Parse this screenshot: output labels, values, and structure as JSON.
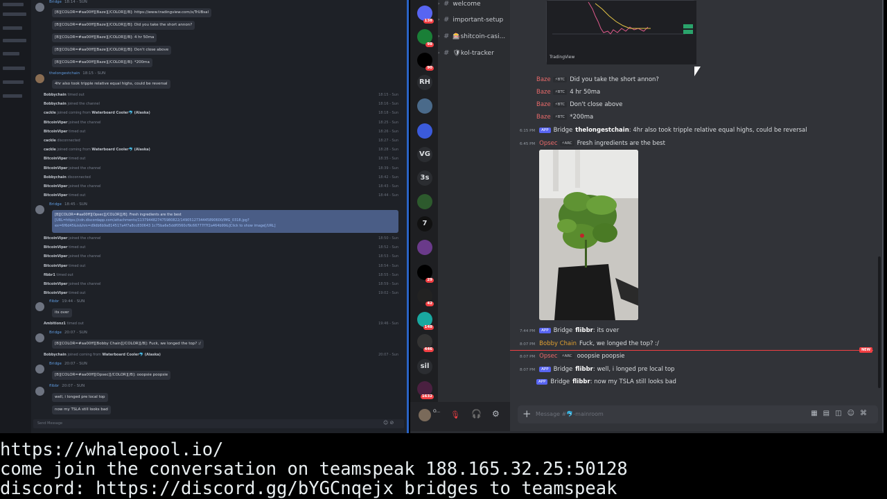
{
  "teamspeak": {
    "messages": [
      {
        "name": "Bridge",
        "time": "18:14 - SUN",
        "lines": [
          "[B][COLOR=#aa00ff][Baze][/COLOR][/B]: https://www.tradingview.com/x/TrUBsal",
          "[B][COLOR=#aa00ff][Baze][/COLOR][/B]: Did you take the short annon?",
          "[B][COLOR=#aa00ff][Baze][/COLOR][/B]: 4 hr 50ma",
          "[B][COLOR=#aa00ff][Baze][/COLOR][/B]: Don't close above",
          "[B][COLOR=#aa00ff][Baze][/COLOR][/B]: *200ma"
        ]
      },
      {
        "name": "thelongestchain",
        "time": "18:15 - SUN",
        "lines": [
          "4hr also took tripple relative equal highs, could be reversal"
        ]
      }
    ],
    "events1": [
      {
        "user": "Bobbychain",
        "text": "timed out",
        "time": "18:15 - Sun"
      },
      {
        "user": "Bobbychain",
        "text": "joined the channel",
        "time": "18:16 - Sun"
      },
      {
        "user": "cackle",
        "text": "joined coming from",
        "extra": "Waterboard Cooler🐬 (Alaska)",
        "time": "18:18 - Sun"
      },
      {
        "user": "BitcoinViper",
        "text": "joined the channel",
        "time": "18:25 - Sun"
      },
      {
        "user": "BitcoinViper",
        "text": "timed out",
        "time": "18:26 - Sun"
      },
      {
        "user": "cackle",
        "text": "disconnected",
        "time": "18:27 - Sun"
      },
      {
        "user": "cackle",
        "text": "joined coming from",
        "extra": "Waterboard Cooler🐬 (Alaska)",
        "time": "18:28 - Sun"
      },
      {
        "user": "BitcoinViper",
        "text": "timed out",
        "time": "18:35 - Sun"
      },
      {
        "user": "BitcoinViper",
        "text": "joined the channel",
        "time": "18:39 - Sun"
      },
      {
        "user": "Bobbychain",
        "text": "disconnected",
        "time": "18:42 - Sun"
      },
      {
        "user": "BitcoinViper",
        "text": "joined the channel",
        "time": "18:43 - Sun"
      },
      {
        "user": "BitcoinViper",
        "text": "timed out",
        "time": "18:44 - Sun"
      }
    ],
    "hl": {
      "name": "Bridge",
      "time": "18:45 - SUN",
      "line1": "[B][COLOR=#aa00ff][Opsec][/COLOR][/B]: Fresh ingredients are the best",
      "line2": "[URL=https://cdn.discordapp.com/attachments/1137944827475980822/1490512734445890600/IMG_0318.jpg?",
      "line3": "ex=6f6d45&is&hm=d9db6b9a814517a4f7a8cc830643 1c75ba6e5ddf0560cf9c66777f7f2a464b99&]Click to show image[/URL]"
    },
    "events2": [
      {
        "user": "BitcoinViper",
        "text": "joined the channel",
        "time": "18:50 - Sun"
      },
      {
        "user": "BitcoinViper",
        "text": "timed out",
        "time": "18:52 - Sun"
      },
      {
        "user": "BitcoinViper",
        "text": "joined the channel",
        "time": "18:53 - Sun"
      },
      {
        "user": "BitcoinViper",
        "text": "timed out",
        "time": "18:54 - Sun"
      },
      {
        "user": "fibbr1",
        "text": "timed out",
        "time": "18:55 - Sun"
      },
      {
        "user": "BitcoinViper",
        "text": "joined the channel",
        "time": "18:59 - Sun"
      },
      {
        "user": "BitcoinViper",
        "text": "timed out",
        "time": "19:02 - Sun"
      }
    ],
    "m3": {
      "name": "flibbr",
      "time": "19:44 - SUN",
      "line": "its over"
    },
    "ev3": {
      "user": "Ambitionz1",
      "text": "timed out",
      "time": "19:46 - Sun"
    },
    "m4": {
      "name": "Bridge",
      "time": "20:07 - SUN",
      "line": "[B][COLOR=#aa00ff][Bobby Chain][/COLOR][/B]: Fuck, we longed the top? :/"
    },
    "ev4": {
      "user": "Bobbychain",
      "text": "joined coming from",
      "extra": "Waterboard Cooler🐬 (Alaska)",
      "time": "20:07 - Sun"
    },
    "m5": {
      "name": "Bridge",
      "time": "20:07 - SUN",
      "line": "[B][COLOR=#aa00ff][Opsec][/COLOR][/B]: ooopsie poopsie"
    },
    "m6": {
      "name": "flibbr",
      "time": "20:07 - SUN",
      "lines": [
        "well, i longed pre local top",
        "now my TSLA still looks bad"
      ]
    },
    "input_placeholder": "Send Message"
  },
  "discord": {
    "servers": [
      {
        "label": "",
        "badge": "138"
      },
      {
        "label": "",
        "badge": "98"
      },
      {
        "label": "",
        "badge": "90"
      },
      {
        "label": "RH",
        "badge": ""
      },
      {
        "label": "",
        "badge": ""
      },
      {
        "label": "",
        "badge": ""
      },
      {
        "label": "VG",
        "badge": ""
      },
      {
        "label": "3s",
        "badge": ""
      },
      {
        "label": "",
        "badge": ""
      },
      {
        "label": "7",
        "badge": ""
      },
      {
        "label": "",
        "badge": ""
      },
      {
        "label": "",
        "badge": "29"
      },
      {
        "label": "",
        "badge": "42"
      },
      {
        "label": "",
        "badge": "148"
      },
      {
        "label": "",
        "badge": "446"
      },
      {
        "label": "sil",
        "badge": ""
      },
      {
        "label": "",
        "badge": "1632"
      }
    ],
    "channels": [
      "welcome",
      "important-setup",
      "🎰shitcoin-casi...",
      "🛡kol-tracker"
    ],
    "chart_brand": "TradingView",
    "messages": [
      {
        "time": "",
        "who": "Baze",
        "tag": "⚡BTC",
        "text": "Did you take the short annon?"
      },
      {
        "time": "",
        "who": "Baze",
        "tag": "⚡BTC",
        "text": "4 hr 50ma"
      },
      {
        "time": "",
        "who": "Baze",
        "tag": "⚡BTC",
        "text": "Don't close above"
      },
      {
        "time": "",
        "who": "Baze",
        "tag": "⚡BTC",
        "text": "*200ma"
      },
      {
        "time": "6:15 PM",
        "app": "APP",
        "who2": "Bridge",
        "bold": "thelongestchain",
        "text": ": 4hr also took tripple relative equal highs, could be reversal"
      },
      {
        "time": "6:45 PM",
        "who": "Opsec",
        "tag": "⚡ARC",
        "text": "Fresh ingredients are the best"
      },
      {
        "time": "7:44 PM",
        "app": "APP",
        "who2": "Bridge",
        "bold": "flibbr",
        "text": ": its over"
      },
      {
        "time": "8:07 PM",
        "who3": "Bobby Chain",
        "text": "Fuck, we longed the top? :/"
      },
      {
        "time": "8:07 PM",
        "who": "Opsec",
        "tag": "⚡ARC",
        "text": "ooopsie poopsie"
      },
      {
        "time": "8:07 PM",
        "app": "APP",
        "who2": "Bridge",
        "bold": "flibbr",
        "text": ": well, i longed pre local top"
      },
      {
        "time": "",
        "app": "APP",
        "who2": "Bridge",
        "bold": "flibbr",
        "text": ": now my TSLA still looks bad"
      }
    ],
    "new_badge": "NEW",
    "input_placeholder": "Message #🐬-mainroom",
    "user_short": "O..."
  },
  "terminal": [
    "https://whalepool.io/",
    "come join the conversation on teamspeak 188.165.32.25:50128",
    "discord: https://discord.gg/bYGCnqejx bridges to teamspeak"
  ]
}
